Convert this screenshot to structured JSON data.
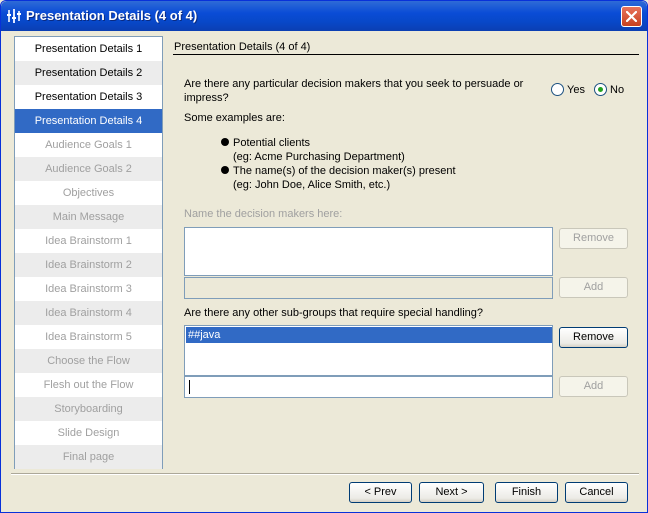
{
  "window": {
    "title": "Presentation Details (4 of 4)"
  },
  "steps": [
    {
      "label": "Presentation Details 1"
    },
    {
      "label": "Presentation Details 2"
    },
    {
      "label": "Presentation Details 3"
    },
    {
      "label": "Presentation Details 4"
    },
    {
      "label": "Audience Goals 1"
    },
    {
      "label": "Audience Goals 2"
    },
    {
      "label": "Objectives"
    },
    {
      "label": "Main Message"
    },
    {
      "label": "Idea Brainstorm 1"
    },
    {
      "label": "Idea Brainstorm 2"
    },
    {
      "label": "Idea Brainstorm 3"
    },
    {
      "label": "Idea Brainstorm 4"
    },
    {
      "label": "Idea Brainstorm 5"
    },
    {
      "label": "Choose the Flow"
    },
    {
      "label": "Flesh out the Flow"
    },
    {
      "label": "Storyboarding"
    },
    {
      "label": "Slide Design"
    },
    {
      "label": "Final page"
    }
  ],
  "panel": {
    "title": "Presentation Details (4 of 4)",
    "question1": "Are there any particular decision makers that you seek to persuade or impress?",
    "yes_label": "Yes",
    "no_label": "No",
    "selected_option": "No",
    "examples_title": "Some examples are:",
    "example1_line1": "Potential clients",
    "example1_line2": "(eg: Acme Purchasing Department)",
    "example2_line1": "The name(s) of the decision maker(s) present",
    "example2_line2": "(eg: John Doe, Alice Smith, etc.)",
    "decision_makers_label": "Name the decision makers here:",
    "question2": "Are there any other sub-groups that require special handling?",
    "subgroup_items": [
      "##java"
    ],
    "remove_label": "Remove",
    "add_label": "Add",
    "subgroup_input_value": ""
  },
  "nav": {
    "prev_label": "< Prev",
    "next_label": "Next >",
    "finish_label": "Finish",
    "cancel_label": "Cancel"
  }
}
